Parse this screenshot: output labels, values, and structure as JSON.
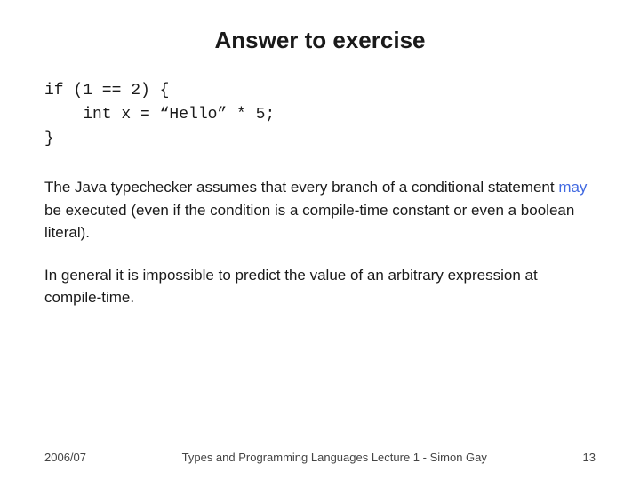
{
  "slide": {
    "title": "Answer to exercise",
    "code": {
      "line1": "if (1 == 2) {",
      "line2": "    int x = “Hello” * 5;",
      "line3": "}"
    },
    "paragraph1": {
      "part1": "The Java typechecker assumes that every branch of a\nconditional statement ",
      "highlight": "may",
      "part2": " be executed (even if the condition is\na compile-time constant or even a boolean literal)."
    },
    "paragraph2": "In general it is impossible to predict the value of an arbitrary\nexpression at compile-time.",
    "footer": {
      "year": "2006/07",
      "course": "Types and Programming Languages Lecture 1 - Simon Gay",
      "page": "13"
    }
  }
}
